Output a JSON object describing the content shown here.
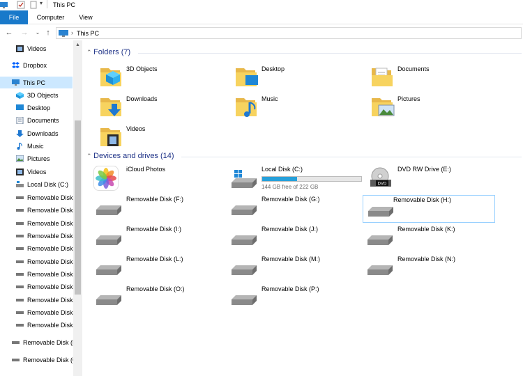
{
  "window": {
    "title": "This PC"
  },
  "ribbon": {
    "tabs": [
      "File",
      "Computer",
      "View"
    ]
  },
  "address": {
    "crumb": "This PC"
  },
  "sidebar": {
    "items": [
      {
        "label": "Videos",
        "icon": "videos-icon"
      },
      {
        "label": "Dropbox",
        "icon": "dropbox-icon"
      },
      {
        "label": "This PC",
        "icon": "this-pc-icon",
        "selected": true
      },
      {
        "label": "3D Objects",
        "icon": "3d-objects-icon"
      },
      {
        "label": "Desktop",
        "icon": "desktop-icon"
      },
      {
        "label": "Documents",
        "icon": "documents-icon"
      },
      {
        "label": "Downloads",
        "icon": "downloads-icon"
      },
      {
        "label": "Music",
        "icon": "music-icon"
      },
      {
        "label": "Pictures",
        "icon": "pictures-icon"
      },
      {
        "label": "Videos",
        "icon": "videos-icon"
      },
      {
        "label": "Local Disk (C:)",
        "icon": "local-disk-icon"
      },
      {
        "label": "Removable Disk",
        "icon": "removable-disk-icon"
      },
      {
        "label": "Removable Disk",
        "icon": "removable-disk-icon"
      },
      {
        "label": "Removable Disk",
        "icon": "removable-disk-icon"
      },
      {
        "label": "Removable Disk",
        "icon": "removable-disk-icon"
      },
      {
        "label": "Removable Disk",
        "icon": "removable-disk-icon"
      },
      {
        "label": "Removable Disk",
        "icon": "removable-disk-icon"
      },
      {
        "label": "Removable Disk",
        "icon": "removable-disk-icon"
      },
      {
        "label": "Removable Disk",
        "icon": "removable-disk-icon"
      },
      {
        "label": "Removable Disk",
        "icon": "removable-disk-icon"
      },
      {
        "label": "Removable Disk",
        "icon": "removable-disk-icon"
      },
      {
        "label": "Removable Disk",
        "icon": "removable-disk-icon"
      },
      {
        "label": "Removable Disk (F",
        "icon": "removable-disk-icon"
      },
      {
        "label": "Removable Disk (G",
        "icon": "removable-disk-icon"
      }
    ]
  },
  "folders": {
    "header": "Folders (7)",
    "items": [
      {
        "label": "3D Objects",
        "icon": "3d-objects-folder-icon"
      },
      {
        "label": "Desktop",
        "icon": "desktop-folder-icon"
      },
      {
        "label": "Documents",
        "icon": "documents-folder-icon"
      },
      {
        "label": "Downloads",
        "icon": "downloads-folder-icon"
      },
      {
        "label": "Music",
        "icon": "music-folder-icon"
      },
      {
        "label": "Pictures",
        "icon": "pictures-folder-icon"
      },
      {
        "label": "Videos",
        "icon": "videos-folder-icon"
      }
    ]
  },
  "drives": {
    "header": "Devices and drives (14)",
    "items": [
      {
        "label": "iCloud Photos",
        "icon": "icloud-photos-icon"
      },
      {
        "label": "Local Disk (C:)",
        "icon": "local-disk-icon",
        "free_text": "144 GB free of 222 GB",
        "used_fraction": 0.35
      },
      {
        "label": "DVD RW Drive (E:)",
        "icon": "dvd-drive-icon"
      },
      {
        "label": "Removable Disk (F:)",
        "icon": "removable-disk-icon"
      },
      {
        "label": "Removable Disk (G:)",
        "icon": "removable-disk-icon"
      },
      {
        "label": "Removable Disk (H:)",
        "icon": "removable-disk-icon",
        "selected": true
      },
      {
        "label": "Removable Disk (I:)",
        "icon": "removable-disk-icon"
      },
      {
        "label": "Removable Disk (J:)",
        "icon": "removable-disk-icon"
      },
      {
        "label": "Removable Disk (K:)",
        "icon": "removable-disk-icon"
      },
      {
        "label": "Removable Disk (L:)",
        "icon": "removable-disk-icon"
      },
      {
        "label": "Removable Disk (M:)",
        "icon": "removable-disk-icon"
      },
      {
        "label": "Removable Disk (N:)",
        "icon": "removable-disk-icon"
      },
      {
        "label": "Removable Disk (O:)",
        "icon": "removable-disk-icon"
      },
      {
        "label": "Removable Disk (P:)",
        "icon": "removable-disk-icon"
      }
    ]
  }
}
